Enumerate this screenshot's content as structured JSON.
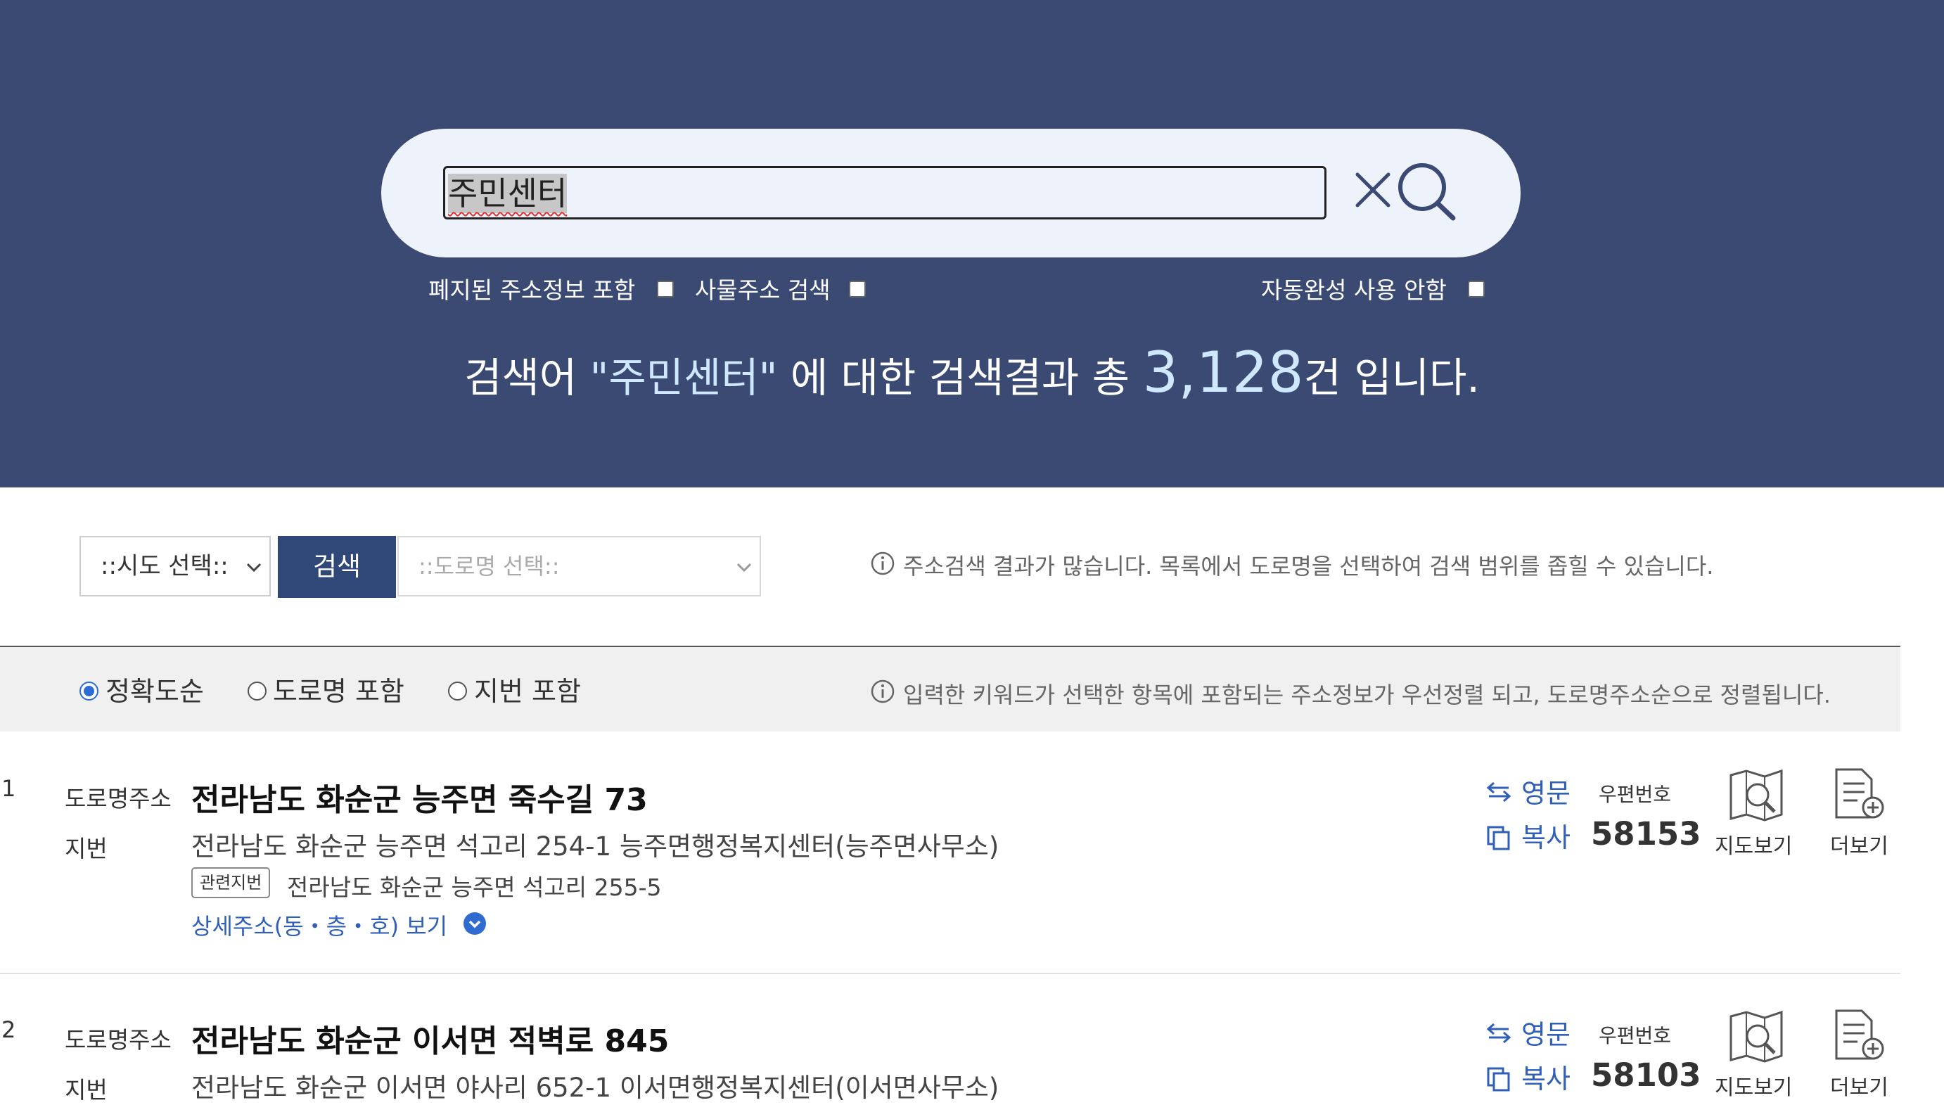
{
  "search": {
    "value": "주민센터",
    "clear_icon": "close-icon",
    "submit_icon": "magnifier-icon"
  },
  "options": {
    "include_abolished": "폐지된 주소정보 포함",
    "thing_address": "사물주소 검색",
    "no_autocomplete": "자동완성 사용 안함"
  },
  "summary": {
    "prefix": "검색어 ",
    "keyword": "\"주민센터\"",
    "middle": " 에 대한 검색결과 총 ",
    "count": "3,128",
    "suffix": "건 입니다."
  },
  "filters": {
    "sido_placeholder": "::시도 선택::",
    "search_button": "검색",
    "road_placeholder": "::도로명 선택::",
    "hint": "주소검색 결과가 많습니다. 목록에서 도로명을 선택하여 검색 범위를 좁힐 수 있습니다."
  },
  "sort": {
    "options": [
      {
        "label": "정확도순",
        "selected": true
      },
      {
        "label": "도로명 포함",
        "selected": false
      },
      {
        "label": "지번 포함",
        "selected": false
      }
    ],
    "hint": "입력한 키워드가 선택한 항목에 포함되는 주소정보가 우선정렬 되고, 도로명주소순으로 정렬됩니다."
  },
  "labels": {
    "road_address": "도로명주소",
    "jibun": "지번",
    "related_jibun": "관련지번",
    "detail_link": "상세주소(동・층・호) 보기",
    "english": "영문",
    "copy": "복사",
    "zip_label": "우편번호",
    "map_view": "지도보기",
    "more_view": "더보기"
  },
  "results": [
    {
      "no": "1",
      "road": "전라남도 화순군 능주면 죽수길 73",
      "jibun": "전라남도 화순군 능주면 석고리 254-1 능주면행정복지센터(능주면사무소)",
      "related": "전라남도 화순군 능주면 석고리 255-5",
      "zip": "58153"
    },
    {
      "no": "2",
      "road": "전라남도 화순군 이서면 적벽로 845",
      "jibun": "전라남도 화순군 이서면 야사리 652-1 이서면행정복지센터(이서면사무소)",
      "zip": "58103"
    }
  ],
  "colors": {
    "header_bg": "#3b4a72",
    "accent_blue": "#2f5fb8",
    "button_bg": "#2f4878"
  }
}
